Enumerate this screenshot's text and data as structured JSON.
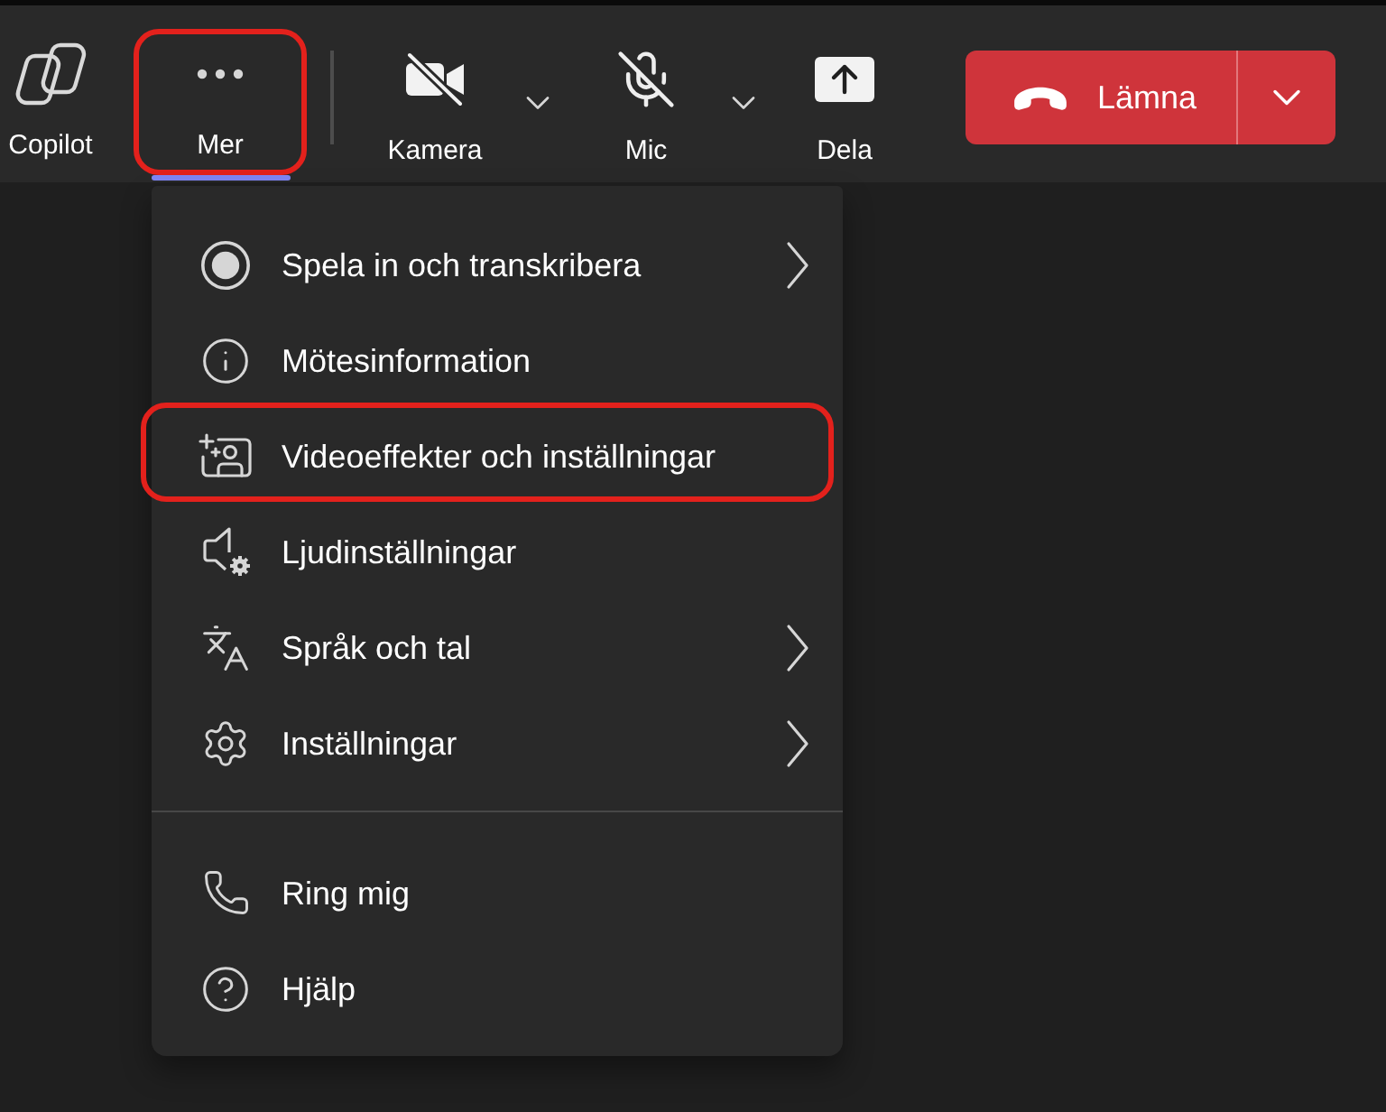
{
  "toolbar": {
    "apps": [
      {
        "kind": "copilot",
        "label": "Copilot",
        "selected": false,
        "highlighted": false
      },
      {
        "kind": "more",
        "label": "Mer",
        "selected": true,
        "highlighted": true
      }
    ],
    "devices": [
      {
        "kind": "camera",
        "label": "Kamera",
        "off": true
      },
      {
        "kind": "mic",
        "label": "Mic",
        "off": true
      }
    ],
    "share": {
      "label": "Dela"
    },
    "leave": {
      "label": "Lämna"
    }
  },
  "menu": {
    "sections": [
      {
        "items": [
          {
            "kind": "record",
            "label": "Spela in och transkribera",
            "submenu": true,
            "highlighted": false
          },
          {
            "kind": "info",
            "label": "Mötesinformation",
            "submenu": false,
            "highlighted": false
          },
          {
            "kind": "video",
            "label": "Videoeffekter och inställningar",
            "submenu": false,
            "highlighted": true
          },
          {
            "kind": "audio",
            "label": "Ljudinställningar",
            "submenu": false,
            "highlighted": false
          },
          {
            "kind": "language",
            "label": "Språk och tal",
            "submenu": true,
            "highlighted": false
          },
          {
            "kind": "settings",
            "label": "Inställningar",
            "submenu": true,
            "highlighted": false
          }
        ]
      },
      {
        "items": [
          {
            "kind": "call",
            "label": "Ring mig",
            "submenu": false,
            "highlighted": false
          },
          {
            "kind": "help",
            "label": "Hjälp",
            "submenu": false,
            "highlighted": false
          }
        ]
      }
    ]
  }
}
